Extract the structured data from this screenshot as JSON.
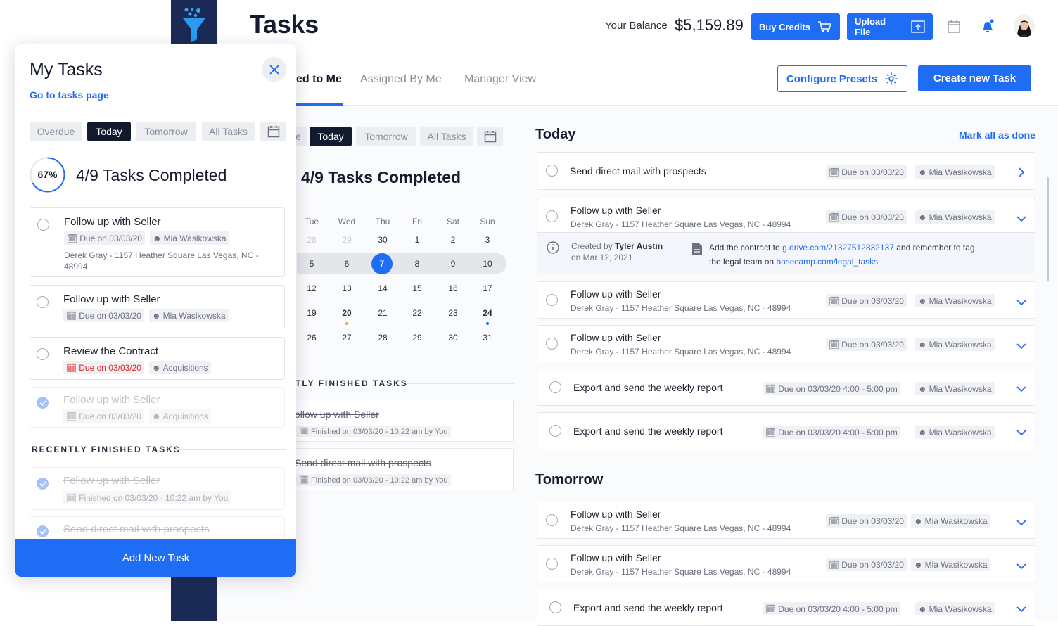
{
  "header": {
    "title": "Tasks",
    "balance_label": "Your Balance",
    "balance_value": "$5,159.89",
    "buy_credits": "Buy Credits",
    "upload_file": "Upload File"
  },
  "subnav": {
    "tabs": [
      {
        "label": "ed to Me"
      },
      {
        "label": "Assigned By Me"
      },
      {
        "label": "Manager View"
      }
    ],
    "configure_presets": "Configure Presets",
    "create_task": "Create new Task"
  },
  "middle": {
    "filters": [
      "e",
      "Today",
      "Tomorrow",
      "All Tasks"
    ],
    "completed": "4/9 Tasks Completed",
    "calendar": {
      "weekdays": [
        "Tue",
        "Wed",
        "Thu",
        "Fri",
        "Sat",
        "Sun"
      ],
      "weeks": [
        [
          "28",
          "29",
          "30",
          "1",
          "2",
          "3"
        ],
        [
          "5",
          "6",
          "7",
          "8",
          "9",
          "10"
        ],
        [
          "12",
          "13",
          "14",
          "15",
          "16",
          "17"
        ],
        [
          "19",
          "20",
          "21",
          "22",
          "23",
          "24"
        ],
        [
          "26",
          "27",
          "28",
          "29",
          "30",
          "31"
        ]
      ],
      "selected": "7"
    },
    "recent_label": "TLY FINISHED TASKS",
    "finished": [
      {
        "title": "ollow up with Seller",
        "meta": "Finished on 03/03/20 - 10:22 am by You"
      },
      {
        "title": "Send direct mail with prospects",
        "meta": "Finished on 03/03/20 - 10:22 am by You"
      }
    ]
  },
  "right": {
    "today_title": "Today",
    "mark_all": "Mark all as done",
    "tomorrow_title": "Tomorrow",
    "today_tasks": [
      {
        "title": "Send direct mail with prospects",
        "due": "Due on 03/03/20",
        "assignee": "Mia Wasikowska"
      },
      {
        "title": "Follow up with Seller",
        "sub": "Derek Gray - 1157 Heather Square Las Vegas, NC - 48994",
        "due": "Due on 03/03/20",
        "assignee": "Mia Wasikowska",
        "created_prefix": "Created by",
        "created_by": "Tyler Austin",
        "created_on": "on Mar 12, 2021",
        "note_a": "Add the contract to",
        "note_link1": "g.drive.com/21327512832137",
        "note_b": "and remember to tag",
        "note_c": "the legal team on",
        "note_link2": "basecamp.com/legal_tasks"
      },
      {
        "title": "Follow up with Seller",
        "sub": "Derek Gray - 1157 Heather Square Las Vegas, NC - 48994",
        "due": "Due on 03/03/20",
        "assignee": "Mia Wasikowska"
      },
      {
        "title": "Follow up with Seller",
        "sub": "Derek Gray - 1157 Heather Square Las Vegas, NC - 48994",
        "due": "Due on 03/03/20",
        "assignee": "Mia Wasikowska"
      },
      {
        "title": "Export and send the weekly report",
        "due": "Due on 03/03/20  4:00 - 5:00 pm",
        "assignee": "Mia Wasikowska"
      },
      {
        "title": "Export and send the weekly report",
        "due": "Due on 03/03/20  4:00 - 5:00 pm",
        "assignee": "Mia Wasikowska"
      }
    ],
    "tomorrow_tasks": [
      {
        "title": "Follow up with Seller",
        "sub": "Derek Gray - 1157 Heather Square Las Vegas, NC - 48994",
        "due": "Due on 03/03/20",
        "assignee": "Mia Wasikowska"
      },
      {
        "title": "Follow up with Seller",
        "sub": "Derek Gray - 1157 Heather Square Las Vegas, NC - 48994",
        "due": "Due on 03/03/20",
        "assignee": "Mia Wasikowska"
      },
      {
        "title": "Export and send the weekly report",
        "due": "Due on 03/03/20  4:00 - 5:00 pm",
        "assignee": "Mia Wasikowska"
      }
    ]
  },
  "panel": {
    "title": "My Tasks",
    "link": "Go to tasks page",
    "filters": [
      "Overdue",
      "Today",
      "Tomorrow",
      "All Tasks"
    ],
    "progress_label": "67%",
    "progress": 0.67,
    "completed": "4/9 Tasks Completed",
    "tasks": [
      {
        "title": "Follow up with Seller",
        "due": "Due on 03/03/20",
        "assignee": "Mia Wasikowska",
        "address": "Derek Gray - 1157 Heather Square Las Vegas, NC - 48994"
      },
      {
        "title": "Follow up with Seller",
        "due": "Due on 03/03/20",
        "assignee": "Mia Wasikowska"
      },
      {
        "title": "Review the Contract",
        "due": "Due on 03/03/20",
        "assignee": "Acquisitions"
      },
      {
        "title": "Follow up with Seller",
        "due": "Due on 03/03/20",
        "assignee": "Acquisitions"
      }
    ],
    "recent_label": "RECENTLY FINISHED TASKS",
    "finished": [
      {
        "title": "Follow up with Seller",
        "meta": "Finished on 03/03/20 - 10:22 am by You"
      },
      {
        "title": "Send direct mail with prospects"
      }
    ],
    "add_button": "Add New Task"
  },
  "colors": {
    "accent": "#1f6cf5",
    "sidebar": "#1b2a55",
    "danger": "#e02424"
  }
}
